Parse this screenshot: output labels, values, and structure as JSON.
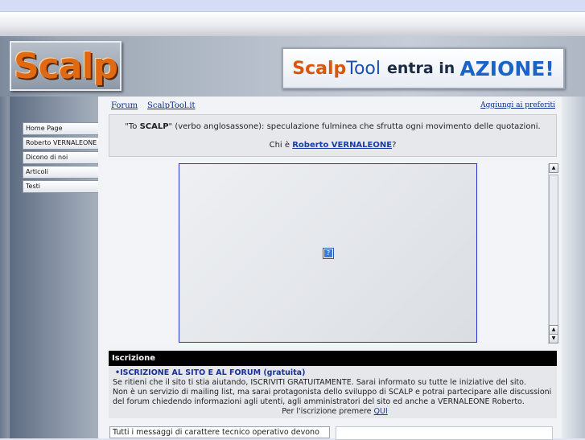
{
  "header": {
    "logo_text": "Scalp",
    "banner": {
      "brand_a": "Scalp",
      "brand_b": "Tool",
      "tagline": "entra in",
      "highlight": "AZIONE!"
    }
  },
  "top_links": {
    "forum": "Forum",
    "scalptool": "ScalpTool.it",
    "favorites": "Aggiungi ai preferiti"
  },
  "sidebar": {
    "items": [
      {
        "label": "Home Page"
      },
      {
        "label": "Roberto VERNALEONE"
      },
      {
        "label": "Dicono di noi"
      },
      {
        "label": "Articoli"
      },
      {
        "label": "Testi"
      }
    ]
  },
  "quote": {
    "open": "\"To",
    "term": "SCALP",
    "rest": "\" (verbo anglosassone): speculazione fulminea che sfrutta ogni movimento delle quotazioni.",
    "who_prefix": "Chi è",
    "who_link": "Roberto VERNALEONE",
    "who_suffix": "?"
  },
  "embed": {
    "icon": "broken-image-icon"
  },
  "iscrizione": {
    "title": "Iscrizione",
    "link": "ISCRIZIONE AL SITO E AL FORUM (gratuita)",
    "line1": "Se ritieni che il sito ti stia aiutando, ISCRIVITI GRATUITAMENTE. Sarai informato su tutte le iniziative del sito.",
    "line2": "Non è un servizio di mailing list, ma sarai protagonista dello sviluppo di SCALP e potrai partecipare alle discussioni del forum chiedendo informazioni agli utenti, agli amministratori del sito ed anche a VERNALEONE Roberto.",
    "line3_prefix": "Per l'iscrizione premere",
    "line3_link": "QUI"
  },
  "bottom": {
    "left_text": "Tutti i messaggi di carattere tecnico operativo devono"
  },
  "colors": {
    "accent_orange": "#e06a14",
    "link_blue": "#1b3da4",
    "header_black": "#000000"
  }
}
